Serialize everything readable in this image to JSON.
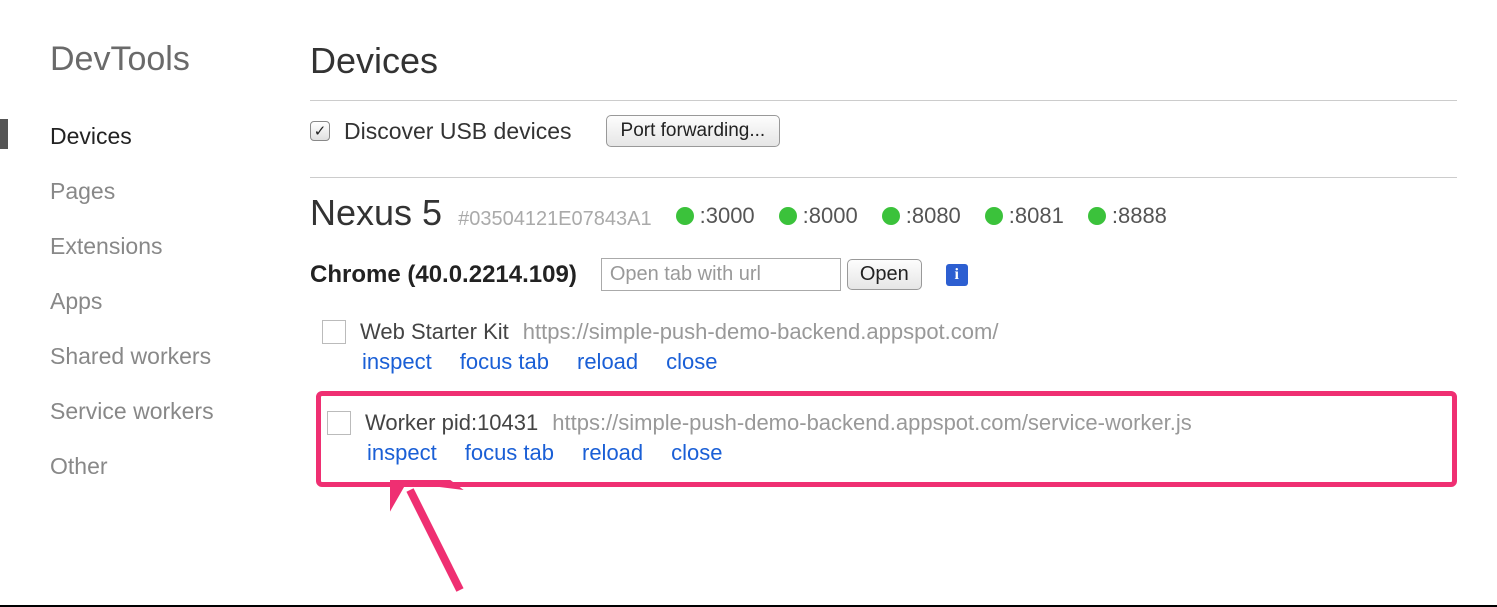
{
  "sidebar": {
    "title": "DevTools",
    "items": [
      {
        "label": "Devices",
        "active": true
      },
      {
        "label": "Pages",
        "active": false
      },
      {
        "label": "Extensions",
        "active": false
      },
      {
        "label": "Apps",
        "active": false
      },
      {
        "label": "Shared workers",
        "active": false
      },
      {
        "label": "Service workers",
        "active": false
      },
      {
        "label": "Other",
        "active": false
      }
    ]
  },
  "page": {
    "title": "Devices",
    "discover_label": "Discover USB devices",
    "port_forwarding_label": "Port forwarding..."
  },
  "device": {
    "name": "Nexus 5",
    "id": "#03504121E07843A1",
    "ports": [
      ":3000",
      ":8000",
      ":8080",
      ":8081",
      ":8888"
    ]
  },
  "browser": {
    "label": "Chrome (40.0.2214.109)",
    "url_placeholder": "Open tab with url",
    "open_label": "Open"
  },
  "targets": [
    {
      "title": "Web Starter Kit",
      "url": "https://simple-push-demo-backend.appspot.com/",
      "highlight": false
    },
    {
      "title": "Worker pid:10431",
      "url": "https://simple-push-demo-backend.appspot.com/service-worker.js",
      "highlight": true
    }
  ],
  "actions": {
    "inspect": "inspect",
    "focus_tab": "focus tab",
    "reload": "reload",
    "close": "close"
  }
}
